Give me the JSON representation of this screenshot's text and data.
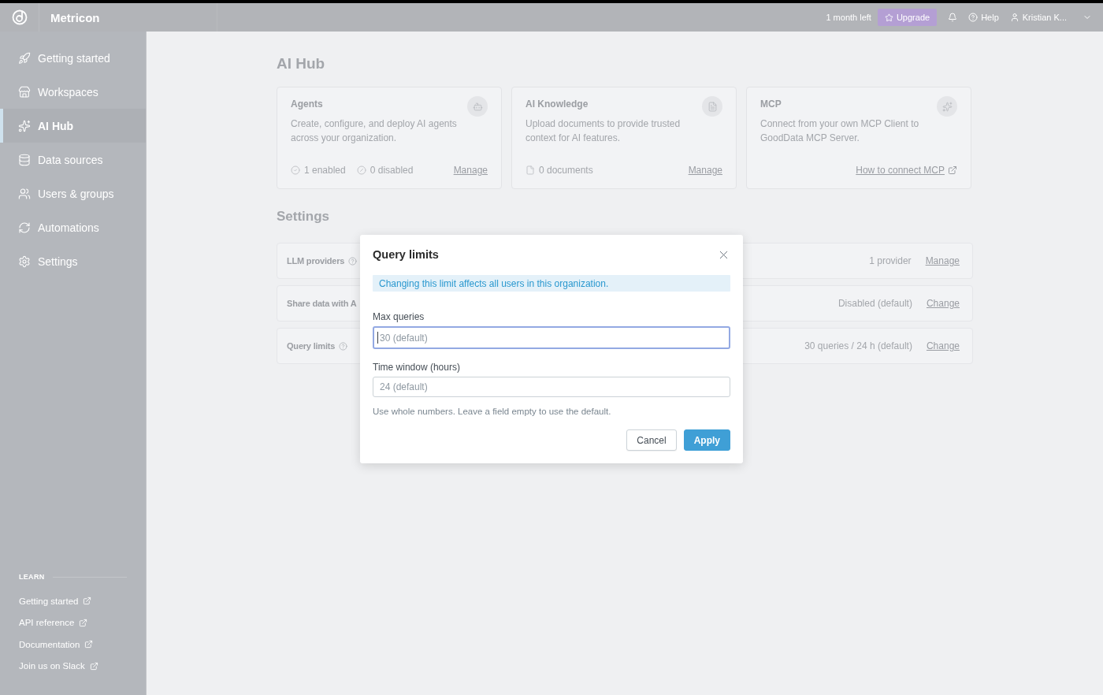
{
  "header": {
    "brand": "Metricon",
    "trial": "1 month left",
    "upgrade": "Upgrade",
    "help": "Help",
    "user": "Kristian K..."
  },
  "sidebar": {
    "items": [
      {
        "label": "Getting started",
        "selected": false
      },
      {
        "label": "Workspaces",
        "selected": false
      },
      {
        "label": "AI Hub",
        "selected": true
      },
      {
        "label": "Data sources",
        "selected": false
      },
      {
        "label": "Users & groups",
        "selected": false
      },
      {
        "label": "Automations",
        "selected": false
      },
      {
        "label": "Settings",
        "selected": false
      }
    ],
    "learn": {
      "title": "LEARN",
      "links": [
        "Getting started",
        "API reference",
        "Documentation",
        "Join us on Slack"
      ]
    }
  },
  "page": {
    "title": "AI Hub",
    "cards": [
      {
        "title": "Agents",
        "description": "Create, configure, and deploy AI agents across your organization.",
        "stats": [
          "1 enabled",
          "0 disabled"
        ],
        "link": {
          "label": "Manage",
          "external": false
        }
      },
      {
        "title": "AI Knowledge",
        "description": "Upload documents to provide trusted context for AI features.",
        "stats": [
          "0 documents"
        ],
        "link": {
          "label": "Manage",
          "external": false
        }
      },
      {
        "title": "MCP",
        "description": "Connect from your own MCP Client to GoodData MCP Server.",
        "link": {
          "label": "How to connect MCP",
          "external": true
        }
      }
    ]
  },
  "settings": {
    "title": "Settings",
    "rows": [
      {
        "label": "LLM providers",
        "help": true,
        "value": "1 provider",
        "action": "Manage"
      },
      {
        "label": "Share data with A",
        "help": false,
        "value": "Disabled (default)",
        "action": "Change"
      },
      {
        "label": "Query limits",
        "help": true,
        "value": "30 queries / 24 h (default)",
        "action": "Change"
      }
    ]
  },
  "dialog": {
    "title": "Query limits",
    "notice": "Changing this limit affects all users in this organization.",
    "fields": [
      {
        "label": "Max queries",
        "placeholder": "30 (default)",
        "focused": true
      },
      {
        "label": "Time window (hours)",
        "placeholder": "24 (default)",
        "focused": false
      }
    ],
    "hint": "Use whole numbers. Leave a field empty to use the default.",
    "buttons": [
      {
        "label": "Cancel",
        "kind": "cancel"
      },
      {
        "label": "Apply",
        "kind": "apply"
      }
    ]
  }
}
